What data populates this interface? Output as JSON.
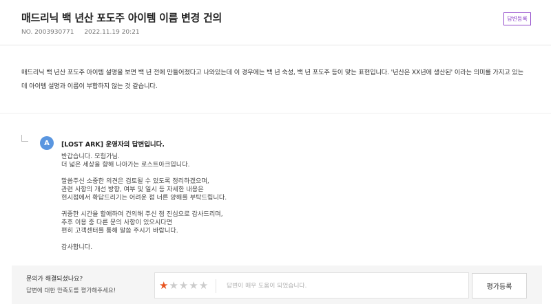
{
  "question": {
    "title": "매드리닉 백 년산 포도주 아이템 이름 변경 건의",
    "number": "NO. 2003930771",
    "datetime": "2022.11.19 20:21",
    "reply_button_label": "답변등록",
    "body": "매드리닉 백 년산 포도주 아이템 설명을 보면 백 년 전에 만들어졌다고 나와있는데 이 경우에는 백 년 숙성, 백 년 포도주 등이 맞는 표현입니다. '년산은 XX년에 생산된' 이라는 의미를 가지고 있는데 아이템 설명과 이름이 부합하지 않는 것 같습니다."
  },
  "answer": {
    "avatar_letter": "A",
    "title": "[LOST ARK] 운영자의 답변입니다.",
    "paragraphs": [
      [
        "반갑습니다. 모험가님.",
        "더 넓은 세상을 향해 나아가는 로스트아크입니다."
      ],
      [
        "말씀주신 소중한 의견은 검토될 수 있도록 정리하겠으며,",
        "관련 사항의 개선 방향, 여부 및 일시 등 자세한 내용은",
        "현시점에서 확답드리기는 어려운 점 너른 양해를 부탁드립니다."
      ],
      [
        "귀중한 시간을 할애하여 건의해 주신 점 진심으로 감사드리며,",
        "추후 이용 중 다른 문의 사항이 있으시다면",
        "편히 고객센터를 통해 말씀 주시기 바랍니다."
      ],
      [
        "감사합니다."
      ]
    ]
  },
  "rating": {
    "question": "문의가 해결되셨나요?",
    "subtext": "답변에 대한 만족도를 평가해주세요!",
    "stars_total": 5,
    "stars_selected": 1,
    "star_color_on": "#e8531f",
    "star_color_off": "#cccccc",
    "input_placeholder": "답변이 매우 도움이 되었습니다.",
    "input_value": "",
    "submit_label": "평가등록"
  },
  "colors": {
    "accent": "#8e44c9",
    "avatar": "#5a96e0",
    "rating_bg": "#f5f5f5"
  }
}
